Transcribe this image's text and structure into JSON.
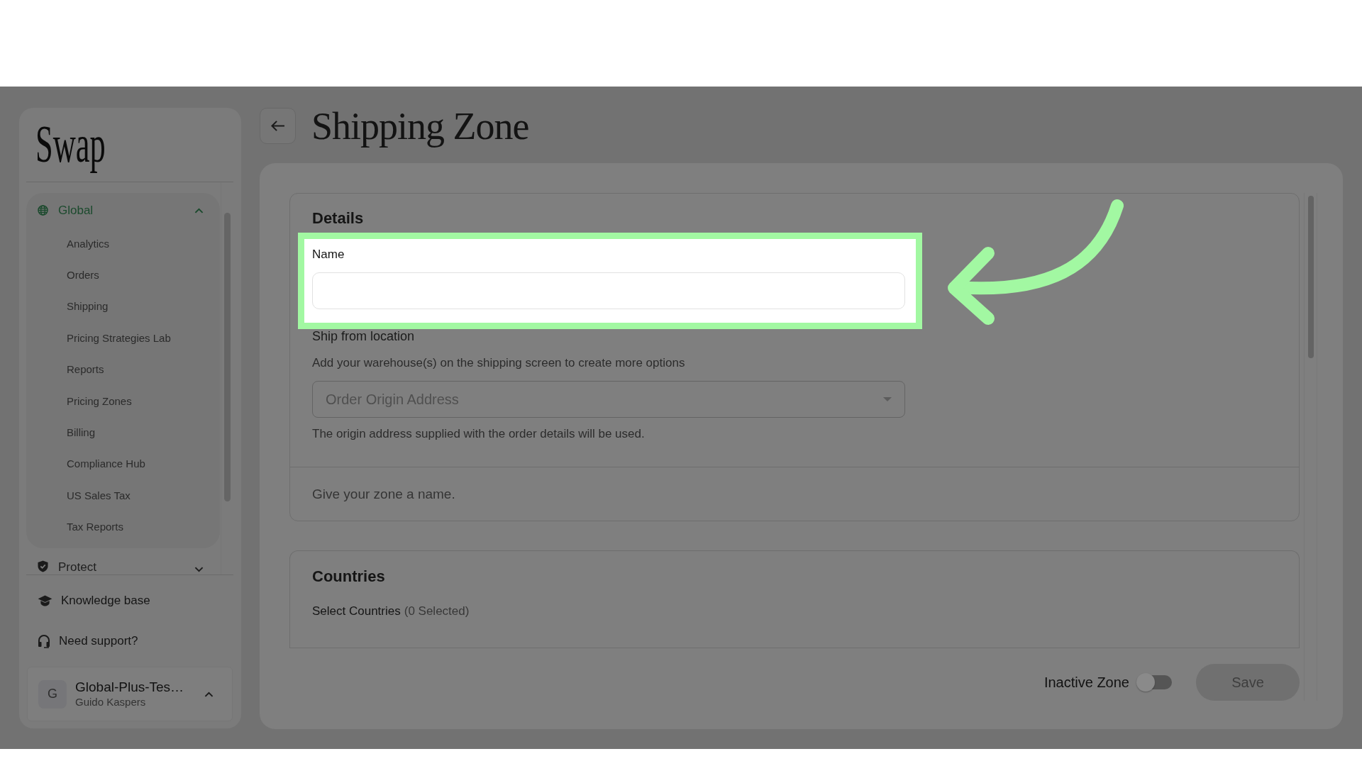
{
  "sidebar": {
    "logo": "Swap",
    "groups": [
      {
        "label": "Global",
        "selected": true,
        "expanded": true,
        "children": [
          {
            "label": "Analytics",
            "selected": false
          },
          {
            "label": "Orders",
            "selected": false
          },
          {
            "label": "Shipping",
            "selected": false
          },
          {
            "label": "Pricing Strategies Lab",
            "selected": false
          },
          {
            "label": "Reports",
            "selected": false
          },
          {
            "label": "Pricing Zones",
            "selected": false
          },
          {
            "label": "Billing",
            "selected": false
          },
          {
            "label": "Compliance Hub",
            "selected": false
          },
          {
            "label": "US Sales Tax",
            "selected": false
          },
          {
            "label": "Tax Reports",
            "selected": false
          }
        ]
      },
      {
        "label": "Protect",
        "selected": false,
        "expanded": false
      }
    ],
    "links": [
      {
        "label": "Knowledge base"
      },
      {
        "label": "Need support?"
      }
    ],
    "account": {
      "initial": "G",
      "name": "Global-Plus-Tes…",
      "user": "Guido Kaspers"
    }
  },
  "header": {
    "title": "Shipping Zone"
  },
  "details": {
    "title": "Details",
    "name_field": {
      "label": "Name",
      "highlighted": true
    },
    "ship_from": {
      "title": "Ship from location",
      "hint": "Add your warehouse(s) on the shipping screen to create more options",
      "select": {
        "placeholder": "Order Origin Address"
      },
      "note": "The origin address supplied with the order details will be used."
    },
    "footer_hint": "Give your zone a name."
  },
  "countries": {
    "title": "Countries",
    "select_label": "Select Countries",
    "count": "(0 Selected)"
  },
  "footer": {
    "toggle": {
      "label": "Inactive Zone",
      "on": false
    },
    "save": {
      "label": "Save",
      "disabled": true
    }
  }
}
